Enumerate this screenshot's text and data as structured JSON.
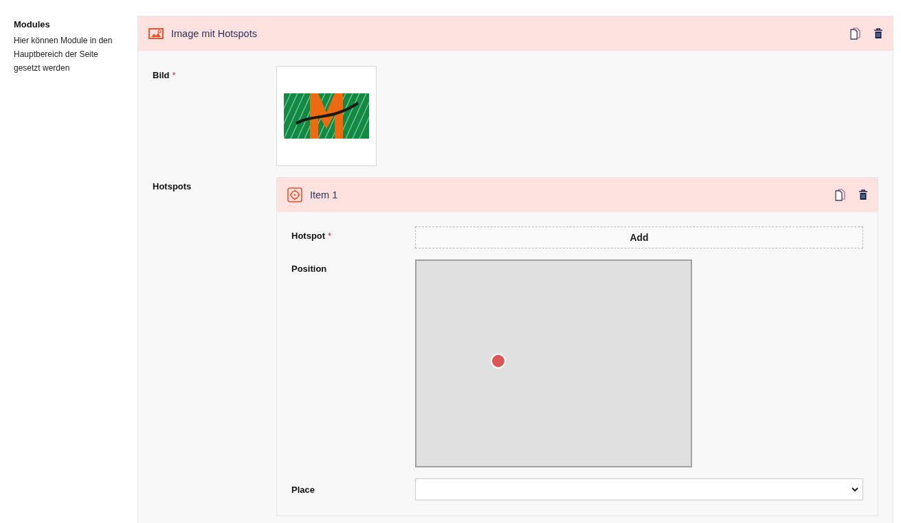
{
  "sidebar": {
    "title": "Modules",
    "description": "Hier können Module in den Hauptbereich der Seite gesetzt werden"
  },
  "module": {
    "title": "Image mit Hotspots",
    "image_field": {
      "label": "Bild",
      "required_mark": "*"
    },
    "hotspots_field": {
      "label": "Hotspots",
      "items": [
        {
          "title": "Item 1",
          "hotspot": {
            "label": "Hotspot",
            "required_mark": "*",
            "button": "Add"
          },
          "position": {
            "label": "Position"
          },
          "place": {
            "label": "Place"
          }
        }
      ]
    }
  }
}
